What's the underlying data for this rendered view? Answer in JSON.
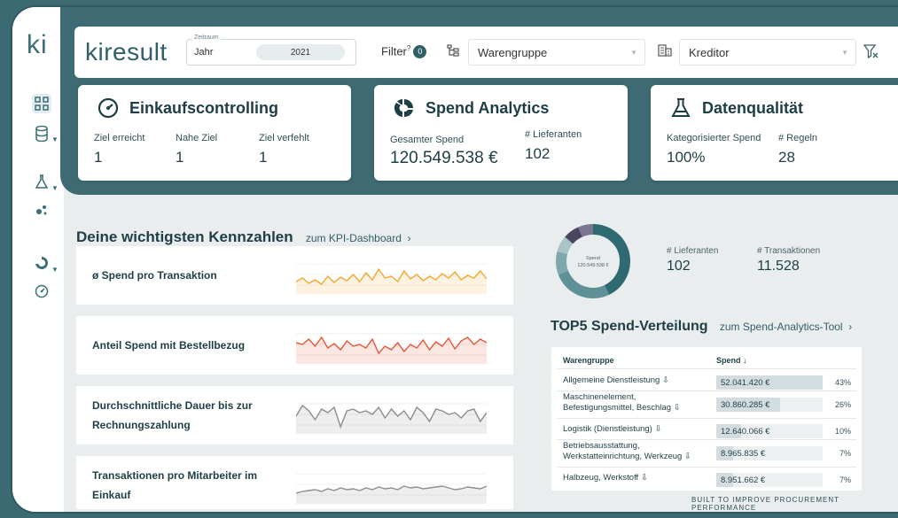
{
  "sidebar": {
    "logo": "ki"
  },
  "topbar": {
    "brand": "kiresult",
    "zeitraum_label": "Zeitraum",
    "zeitraum_value": "Jahr",
    "year": "2021",
    "filter_label": "Filter",
    "filter_count": "0",
    "warengruppe": "Warengruppe",
    "kreditor": "Kreditor"
  },
  "cards": {
    "einkauf": {
      "title": "Einkaufscontrolling",
      "labels": [
        "Ziel erreicht",
        "Nahe Ziel",
        "Ziel verfehlt"
      ],
      "values": [
        "1",
        "1",
        "1"
      ]
    },
    "spend": {
      "title": "Spend Analytics",
      "labels": [
        "Gesamter Spend",
        "# Lieferanten"
      ],
      "values": [
        "120.549.538 €",
        "102"
      ]
    },
    "daten": {
      "title": "Datenqualität",
      "labels": [
        "Kategorisierter Spend",
        "# Regeln"
      ],
      "values": [
        "100%",
        "28"
      ]
    }
  },
  "kpi": {
    "title": "Deine wichtigsten Kennzahlen",
    "link": "zum KPI-Dashboard",
    "rows": [
      {
        "label": "ø Spend pro Transaktion",
        "color": "#f0a82e"
      },
      {
        "label": "Anteil Spend mit Bestellbezug",
        "color": "#e2573a"
      },
      {
        "label": "Durchschnittliche Dauer bis zur Rechnungszahlung",
        "color": "#8a8f91"
      },
      {
        "label": "Transaktionen pro Mitarbeiter im Einkauf",
        "color": "#8a8f91"
      }
    ]
  },
  "donut": {
    "label": "Spend",
    "value": "120.549.538 €"
  },
  "stats": {
    "lief_label": "# Lieferanten",
    "lief_value": "102",
    "trans_label": "# Transaktionen",
    "trans_value": "11.528"
  },
  "top5": {
    "title": "TOP5 Spend-Verteilung",
    "link": "zum Spend-Analytics-Tool",
    "col1": "Warengruppe",
    "col2": "Spend ↓",
    "rows": [
      {
        "cat": "Allgemeine Dienstleistung ⇩",
        "spend": "52.041.420 €",
        "pct": "43%",
        "share": 0.43
      },
      {
        "cat": "Maschinenelement, Befestigungsmittel, Beschlag ⇩",
        "spend": "30.860.285 €",
        "pct": "26%",
        "share": 0.26
      },
      {
        "cat": "Logistik (Dienstleistung) ⇩",
        "spend": "12.640.066 €",
        "pct": "10%",
        "share": 0.1
      },
      {
        "cat": "Betriebsausstattung, Werkstatteinrichtung, Werkzeug ⇩",
        "spend": "8.965.835 €",
        "pct": "7%",
        "share": 0.07
      },
      {
        "cat": "Halbzeug, Werkstoff ⇩",
        "spend": "8.951.662 €",
        "pct": "7%",
        "share": 0.07
      }
    ]
  },
  "footer": "BUILT TO IMPROVE PROCUREMENT PERFORMANCE"
}
